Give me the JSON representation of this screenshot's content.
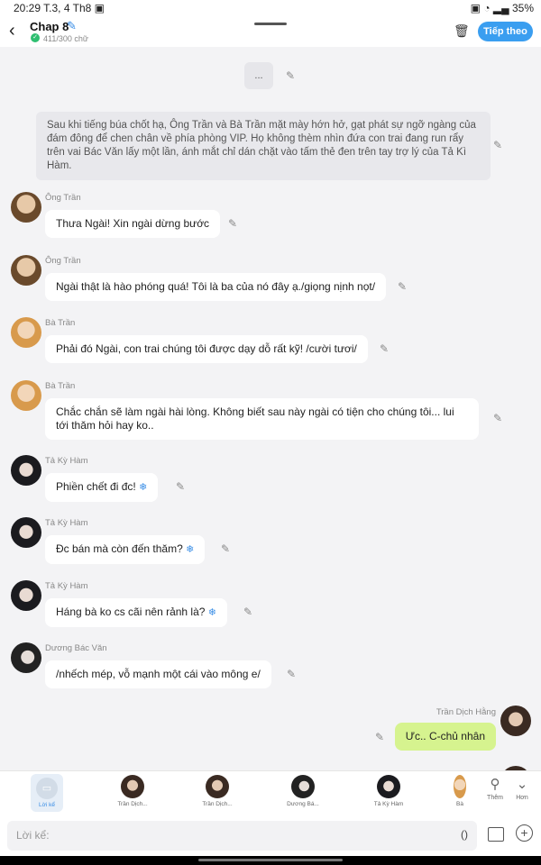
{
  "status": {
    "time": "20:29",
    "date": "T.3, 4 Th8",
    "battery": "35%"
  },
  "header": {
    "title": "Chap 8",
    "word_count": "411/300 chữ",
    "next_label": "Tiếp theo"
  },
  "chat": {
    "ellipsis": "...",
    "narration": "Sau khi tiếng búa chốt hạ, Ông Trần và Bà Trần mặt mày hớn hở, gạt phát sự ngỡ ngàng của đám đông để chen chân về phía phòng VIP. Họ không thèm nhìn đứa con trai đang run rẩy trên vai Bác Văn lấy một lần, ánh mắt chỉ dán chặt vào tấm thẻ đen trên tay trợ lý của Tả Kì Hàm.",
    "messages": [
      {
        "speaker": "Ông Trần",
        "text": "Thưa Ngài! Xin ngài dừng bước"
      },
      {
        "speaker": "Ông Trần",
        "text": "Ngài thật là hào phóng quá! Tôi là ba của nó đây ạ./giọng nịnh nọt/"
      },
      {
        "speaker": "Bà Trần",
        "text": "Phải đó Ngài, con trai chúng tôi được dạy dỗ rất kỹ! /cười tươi/"
      },
      {
        "speaker": "Bà Trần",
        "text": "Chắc chắn sẽ làm ngài hài lòng. Không biết sau này ngài có tiện cho chúng tôi... lui tới thăm hỏi hay ko.."
      },
      {
        "speaker": "Tả Kỳ Hàm",
        "text": "Phiền chết đi đc!"
      },
      {
        "speaker": "Tả Kỳ Hàm",
        "text": "Đc bán mà còn đến thăm?"
      },
      {
        "speaker": "Tả Kỳ Hàm",
        "text": "Háng bà ko cs cãi nên rảnh là?"
      },
      {
        "speaker": "Dương Bác Văn",
        "text": "/nhếch mép, vỗ mạnh một cái vào mông e/"
      },
      {
        "speaker": "Trần Dịch Hằng",
        "text": "Ưc.. C-chủ nhân"
      }
    ]
  },
  "bottom": {
    "narrator_label": "Lời kể",
    "characters": [
      "Trần Dịch...",
      "Trần Dịch...",
      "Dương Bá...",
      "Tả Kỳ Hàm",
      "Bà"
    ],
    "add_label": "Thêm",
    "more_label": "Hơn"
  },
  "input": {
    "placeholder": "Lời kể:",
    "paren": "()"
  },
  "colors": {
    "accent": "#3a9ef0",
    "reply_bubble": "#d6f38f",
    "narration_bg": "#e8e8ec"
  }
}
